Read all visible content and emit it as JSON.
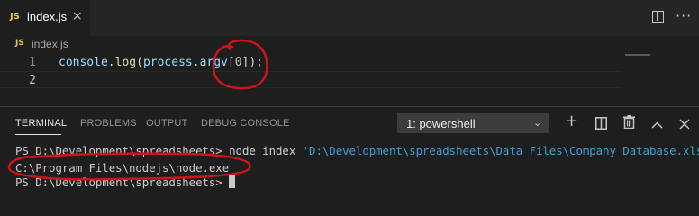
{
  "tab": {
    "badge": "JS",
    "title": "index.js",
    "close": "×"
  },
  "breadcrumb": {
    "badge": "JS",
    "file": "index.js"
  },
  "editor": {
    "lines": [
      {
        "number": "1",
        "tokens": [
          "console",
          ".",
          "log",
          "(",
          "process",
          ".",
          "argv",
          "[",
          "0",
          "]);"
        ]
      },
      {
        "number": "2",
        "tokens": []
      }
    ]
  },
  "panel": {
    "tabs": [
      "TERMINAL",
      "PROBLEMS",
      "OUTPUT",
      "DEBUG CONSOLE"
    ],
    "active_tab": "TERMINAL",
    "terminal_select": "1: powershell",
    "buttons": {
      "add": "+",
      "split": "split-terminal-icon",
      "kill": "trash-icon",
      "maximize": "^",
      "close": "×"
    }
  },
  "terminal": {
    "line1_prompt": "PS D:\\Development\\spreadsheets> ",
    "line1_cmd": "node index ",
    "line1_arg": "'D:\\Development\\spreadsheets\\Data Files\\Company Database.xlsx'",
    "line2": "C:\\Program Files\\nodejs\\node.exe",
    "line3_prompt": "PS D:\\Development\\spreadsheets> "
  },
  "colors": {
    "background": "#1e1e1e",
    "annotation": "#d0141c",
    "js_badge": "#e8c64a"
  }
}
